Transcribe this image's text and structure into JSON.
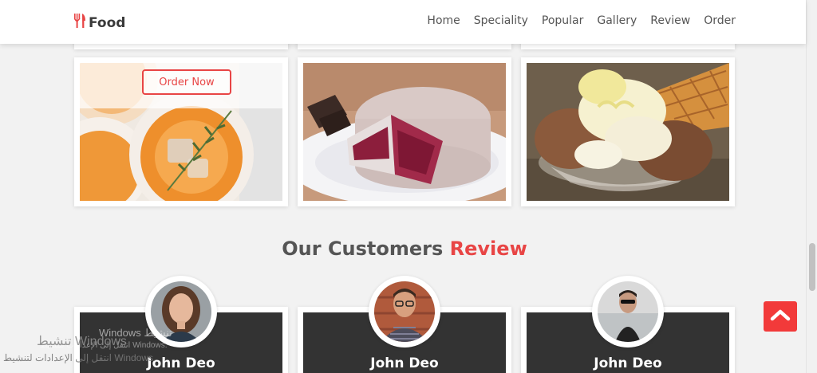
{
  "nav": {
    "logo": "Food",
    "links": [
      "Home",
      "Speciality",
      "Popular",
      "Gallery",
      "Review",
      "Order"
    ]
  },
  "gallery": {
    "order_button": "Order Now",
    "images": [
      "cocktail-glasses-icon",
      "cake-slice-icon",
      "ice-cream-sundae-icon"
    ]
  },
  "reviews": {
    "title": "Our Customers",
    "title_accent": "Review",
    "reviewers": [
      "John Deo",
      "John Deo",
      "John Deo"
    ]
  },
  "watermark": {
    "title": "تنشيط Windows",
    "subtitle": "انتقل إلى الإعدادات لتنشيط Windows.",
    "ghost_title": "Windows تنشيط",
    "ghost_subtitle": "انتقل إلى الإعدادات لتنشيط Windows."
  },
  "colors": {
    "accent": "#e84545",
    "scroll_top_bg": "#f23a3a",
    "review_card_bg": "#333333",
    "page_bg": "#f2f2f2"
  }
}
